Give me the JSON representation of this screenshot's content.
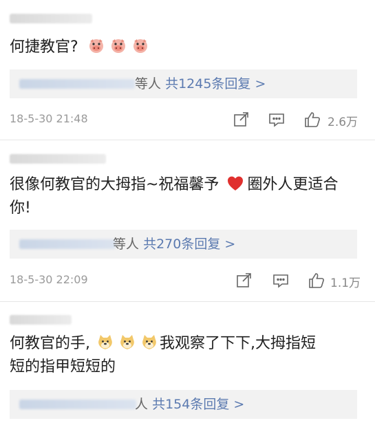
{
  "comments": [
    {
      "text_lines": [
        "何捷教官?"
      ],
      "emoji_count": 3,
      "emoji_type": "pig-face-icon",
      "reply_suffix_deng": "等人",
      "reply_link": "共1245条回复 >",
      "time": "18-5-30 21:48",
      "likes": "2.6万"
    },
    {
      "text_lines": [
        "很像何教官的大拇指~祝福馨予",
        "圈外人更适合",
        "你!"
      ],
      "reply_suffix_deng": "等人",
      "reply_link": "共270条回复 >",
      "time": "18-5-30 22:09",
      "likes": "1.1万"
    },
    {
      "text_lines": [
        "何教官的手,",
        "我观察了下下,大拇指短",
        "短的指甲短短的"
      ],
      "reply_suffix_deng": "人",
      "reply_link": "共154条回复 >"
    }
  ],
  "colors": {
    "link": "#5b7ab0",
    "meta": "#9a9a9a",
    "heart": "#e0302e"
  }
}
